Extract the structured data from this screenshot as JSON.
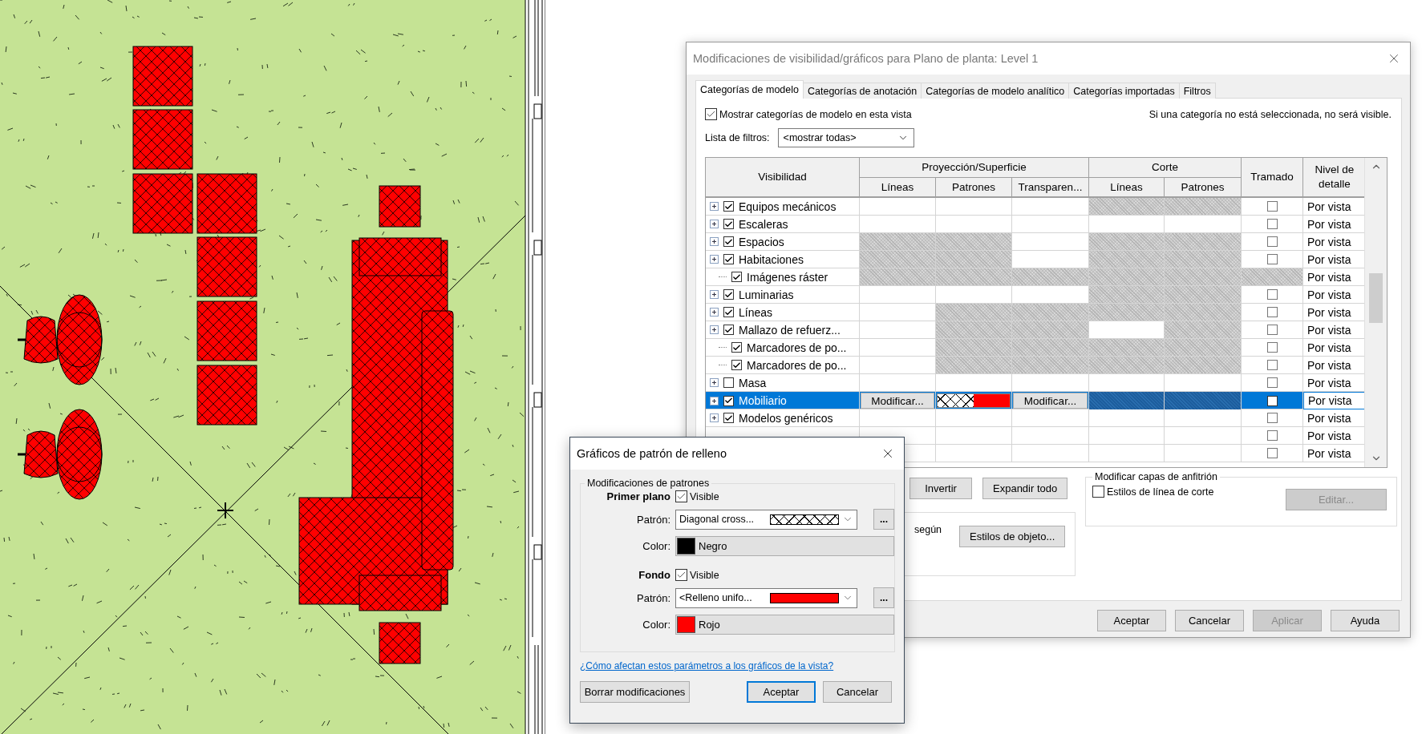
{
  "main_dialog": {
    "title": "Modificaciones de visibilidad/gráficos para Plano de planta: Level 1",
    "tabs": [
      {
        "label": "Categorías de modelo",
        "selected": true
      },
      {
        "label": "Categorías de anotación",
        "selected": false
      },
      {
        "label": "Categorías de modelo analítico",
        "selected": false
      },
      {
        "label": "Categorías importadas",
        "selected": false
      },
      {
        "label": "Filtros",
        "selected": false
      }
    ],
    "show_categories": {
      "label": "Mostrar categorías de modelo en esta vista",
      "checked": true
    },
    "hint": "Si una categoría no está seleccionada, no será visible.",
    "filter": {
      "label": "Lista de filtros:",
      "value": "<mostrar todas>"
    },
    "table": {
      "headers": {
        "visibility": "Visibilidad",
        "projection": "Proyección/Superficie",
        "cut": "Corte",
        "halftone": "Tramado",
        "detail": "Nivel de detalle",
        "projection_columns": [
          "Líneas",
          "Patrones",
          "Transparen..."
        ],
        "cut_columns": [
          "Líneas",
          "Patrones"
        ]
      },
      "rows": [
        {
          "expandable": true,
          "visible": true,
          "name": "Equipos mecánicos",
          "selected": false,
          "cells": [
            {
              "kind": "empty"
            },
            {
              "kind": "empty"
            },
            {
              "kind": "empty"
            },
            {
              "kind": "greyed"
            },
            {
              "kind": "greyed"
            }
          ],
          "halftone": {
            "kind": "checkbox",
            "checked": false
          },
          "detail": "Por vista"
        },
        {
          "expandable": true,
          "visible": true,
          "name": "Escaleras",
          "selected": false,
          "cells": [
            {
              "kind": "empty"
            },
            {
              "kind": "empty"
            },
            {
              "kind": "empty"
            },
            {
              "kind": "empty"
            },
            {
              "kind": "empty"
            }
          ],
          "halftone": {
            "kind": "checkbox",
            "checked": false
          },
          "detail": "Por vista"
        },
        {
          "expandable": true,
          "visible": true,
          "name": "Espacios",
          "selected": false,
          "cells": [
            {
              "kind": "greyed"
            },
            {
              "kind": "greyed"
            },
            {
              "kind": "empty"
            },
            {
              "kind": "greyed"
            },
            {
              "kind": "greyed"
            }
          ],
          "halftone": {
            "kind": "checkbox",
            "checked": false
          },
          "detail": "Por vista"
        },
        {
          "expandable": true,
          "visible": true,
          "name": "Habitaciones",
          "selected": false,
          "cells": [
            {
              "kind": "greyed"
            },
            {
              "kind": "greyed"
            },
            {
              "kind": "empty"
            },
            {
              "kind": "greyed"
            },
            {
              "kind": "greyed"
            }
          ],
          "halftone": {
            "kind": "checkbox",
            "checked": false
          },
          "detail": "Por vista"
        },
        {
          "expandable": false,
          "visible": true,
          "name": "Imágenes ráster",
          "selected": false,
          "cells": [
            {
              "kind": "greyed"
            },
            {
              "kind": "greyed"
            },
            {
              "kind": "greyed"
            },
            {
              "kind": "greyed"
            },
            {
              "kind": "greyed"
            }
          ],
          "halftone": {
            "kind": "greyed"
          },
          "detail": "Por vista"
        },
        {
          "expandable": true,
          "visible": true,
          "name": "Luminarias",
          "selected": false,
          "cells": [
            {
              "kind": "empty"
            },
            {
              "kind": "empty"
            },
            {
              "kind": "empty"
            },
            {
              "kind": "greyed"
            },
            {
              "kind": "greyed"
            }
          ],
          "halftone": {
            "kind": "checkbox",
            "checked": false
          },
          "detail": "Por vista"
        },
        {
          "expandable": true,
          "visible": true,
          "name": "Líneas",
          "selected": false,
          "cells": [
            {
              "kind": "empty"
            },
            {
              "kind": "greyed"
            },
            {
              "kind": "greyed"
            },
            {
              "kind": "greyed"
            },
            {
              "kind": "greyed"
            }
          ],
          "halftone": {
            "kind": "checkbox",
            "checked": false
          },
          "detail": "Por vista"
        },
        {
          "expandable": true,
          "visible": true,
          "name": "Mallazo de refuerz...",
          "selected": false,
          "cells": [
            {
              "kind": "empty"
            },
            {
              "kind": "greyed"
            },
            {
              "kind": "greyed"
            },
            {
              "kind": "empty"
            },
            {
              "kind": "greyed"
            }
          ],
          "halftone": {
            "kind": "checkbox",
            "checked": false
          },
          "detail": "Por vista"
        },
        {
          "expandable": false,
          "visible": true,
          "name": "Marcadores de po...",
          "selected": false,
          "cells": [
            {
              "kind": "empty"
            },
            {
              "kind": "greyed"
            },
            {
              "kind": "greyed"
            },
            {
              "kind": "greyed"
            },
            {
              "kind": "greyed"
            }
          ],
          "halftone": {
            "kind": "checkbox",
            "checked": false
          },
          "detail": "Por vista"
        },
        {
          "expandable": false,
          "visible": true,
          "name": "Marcadores de po...",
          "selected": false,
          "cells": [
            {
              "kind": "empty"
            },
            {
              "kind": "greyed"
            },
            {
              "kind": "greyed"
            },
            {
              "kind": "greyed"
            },
            {
              "kind": "greyed"
            }
          ],
          "halftone": {
            "kind": "checkbox",
            "checked": false
          },
          "detail": "Por vista"
        },
        {
          "expandable": true,
          "visible": false,
          "name": "Masa",
          "selected": false,
          "cells": [
            {
              "kind": "empty"
            },
            {
              "kind": "empty"
            },
            {
              "kind": "empty"
            },
            {
              "kind": "empty"
            },
            {
              "kind": "empty"
            }
          ],
          "halftone": {
            "kind": "checkbox",
            "checked": false
          },
          "detail": "Por vista"
        },
        {
          "expandable": true,
          "visible": true,
          "name": "Mobiliario",
          "selected": true,
          "cells": [
            {
              "kind": "button",
              "text": "Modificar..."
            },
            {
              "kind": "pattern"
            },
            {
              "kind": "button",
              "text": "Modificar..."
            },
            {
              "kind": "greyed"
            },
            {
              "kind": "greyed"
            }
          ],
          "halftone": {
            "kind": "checkbox",
            "checked": false
          },
          "detail": "Por vista"
        },
        {
          "expandable": true,
          "visible": true,
          "name": "Modelos genéricos",
          "selected": false,
          "cells": [
            {
              "kind": "empty"
            },
            {
              "kind": "empty"
            },
            {
              "kind": "empty"
            },
            {
              "kind": "empty"
            },
            {
              "kind": "empty"
            }
          ],
          "halftone": {
            "kind": "checkbox",
            "checked": false
          },
          "detail": "Por vista"
        },
        {
          "selected": false,
          "cells": [
            {
              "kind": "empty"
            },
            {
              "kind": "empty"
            },
            {
              "kind": "empty"
            },
            {
              "kind": "empty"
            },
            {
              "kind": "empty"
            }
          ],
          "halftone": {
            "kind": "checkbox",
            "checked": false
          },
          "detail": "Por vista"
        },
        {
          "selected": false,
          "cells": [
            {
              "kind": "empty"
            },
            {
              "kind": "empty"
            },
            {
              "kind": "empty"
            },
            {
              "kind": "empty"
            },
            {
              "kind": "empty"
            }
          ],
          "halftone": {
            "kind": "checkbox",
            "checked": false
          },
          "detail": "Por vista"
        }
      ]
    },
    "action_buttons": [
      {
        "label": "Invertir"
      },
      {
        "label": "Expandir todo"
      }
    ],
    "override_note": "según",
    "object_styles_button": "Estilos de objeto...",
    "host_layers": {
      "title": "Modificar capas de anfitrión",
      "checkbox": {
        "label": "Estilos de línea de corte",
        "checked": false
      },
      "edit_button": {
        "label": "Editar...",
        "disabled": true
      }
    },
    "footer_buttons": [
      {
        "label": "Aceptar",
        "disabled": false
      },
      {
        "label": "Cancelar",
        "disabled": false
      },
      {
        "label": "Aplicar",
        "disabled": true
      },
      {
        "label": "Ayuda",
        "disabled": false
      }
    ]
  },
  "pattern_dialog": {
    "title": "Gráficos de patrón de relleno",
    "group": "Modificaciones de patrones",
    "sections": [
      {
        "heading": "Primer plano",
        "visible": {
          "label": "Visible",
          "checked": true
        },
        "pattern_label": "Patrón:",
        "pattern": {
          "value": "Diagonal cross...",
          "preview": {
            "kind": "crosshatch"
          }
        },
        "browse": "...",
        "color_label": "Color:",
        "color": {
          "name": "Negro",
          "color": "#000000"
        }
      },
      {
        "heading": "Fondo",
        "visible": {
          "label": "Visible",
          "checked": true
        },
        "pattern_label": "Patrón:",
        "pattern": {
          "value": "<Relleno unifo...",
          "preview": {
            "kind": "solid",
            "color": "#ff0000"
          }
        },
        "browse": "...",
        "color_label": "Color:",
        "color": {
          "name": "Rojo",
          "color": "#ff0000"
        }
      }
    ],
    "link": "¿Cómo afectan estos parámetros a los gráficos de la vista?",
    "buttons": [
      {
        "label": "Borrar modificaciones",
        "default": false
      },
      {
        "label": "Aceptar",
        "default": true
      },
      {
        "label": "Cancelar",
        "default": false
      }
    ]
  }
}
